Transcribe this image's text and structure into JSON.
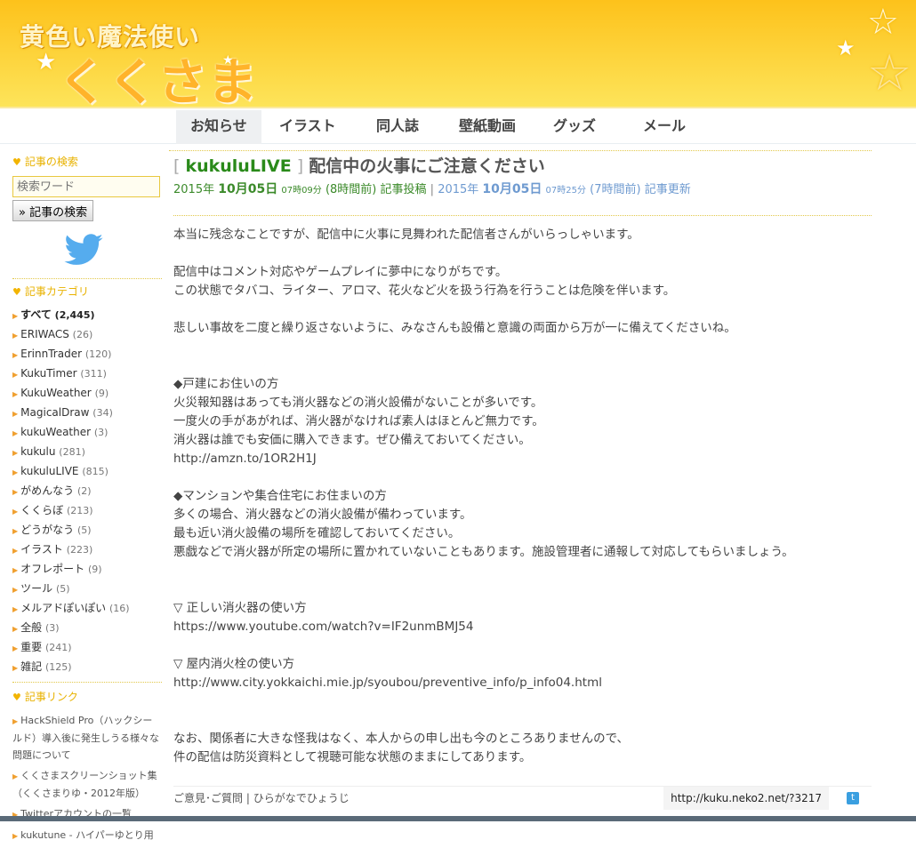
{
  "header": {
    "logo_top": "黄色い魔法使い",
    "logo_main": "くくさま"
  },
  "nav": {
    "tabs": [
      {
        "label": "お知らせ"
      },
      {
        "label": "イラスト"
      },
      {
        "label": "同人誌"
      },
      {
        "label": "壁紙動画"
      },
      {
        "label": "グッズ"
      },
      {
        "label": "メール"
      }
    ]
  },
  "sidebar": {
    "search_heading": "記事の検索",
    "search_placeholder": "検索ワード",
    "search_button": "» 記事の検索",
    "category_heading": "記事カテゴリ",
    "categories": [
      {
        "label": "すべて",
        "count": "(2,445)"
      },
      {
        "label": "ERIWACS",
        "count": "(26)"
      },
      {
        "label": "ErinnTrader",
        "count": "(120)"
      },
      {
        "label": "KukuTimer",
        "count": "(311)"
      },
      {
        "label": "KukuWeather",
        "count": "(9)"
      },
      {
        "label": "MagicalDraw",
        "count": "(34)"
      },
      {
        "label": "kukuWeather",
        "count": "(3)"
      },
      {
        "label": "kukulu",
        "count": "(281)"
      },
      {
        "label": "kukuluLIVE",
        "count": "(815)"
      },
      {
        "label": "がめんなう",
        "count": "(2)"
      },
      {
        "label": "くくらぼ",
        "count": "(213)"
      },
      {
        "label": "どうがなう",
        "count": "(5)"
      },
      {
        "label": "イラスト",
        "count": "(223)"
      },
      {
        "label": "オフレポート",
        "count": "(9)"
      },
      {
        "label": "ツール",
        "count": "(5)"
      },
      {
        "label": "メルアドぽいぽい",
        "count": "(16)"
      },
      {
        "label": "全般",
        "count": "(3)"
      },
      {
        "label": "重要",
        "count": "(241)"
      },
      {
        "label": "雑記",
        "count": "(125)"
      }
    ],
    "links_heading": "記事リンク",
    "links": [
      "HackShield Pro（ハックシールド）導入後に発生しうる様々な問題について",
      "くくさまスクリーンショット集（くくさまりゆ・2012年版）",
      "Twitterアカウントの一覧",
      "kukutune - ハイパーゆとり用"
    ]
  },
  "article": {
    "category": "kukuluLIVE",
    "title": "配信中の火事にご注意ください",
    "posted": {
      "year": "2015年",
      "date": "10月05日",
      "time": "07時09分",
      "ago": "(8時間前)",
      "label": "記事投稿"
    },
    "updated": {
      "year": "2015年",
      "date": "10月05日",
      "time": "07時25分",
      "ago": "(7時間前)",
      "label": "記事更新"
    },
    "sep": "|",
    "lines": [
      "本当に残念なことですが、配信中に火事に見舞われた配信者さんがいらっしゃいます。",
      "",
      "配信中はコメント対応やゲームプレイに夢中になりがちです。",
      "この状態でタバコ、ライター、アロマ、花火など火を扱う行為を行うことは危険を伴います。",
      "",
      "悲しい事故を二度と繰り返さないように、みなさんも設備と意識の両面から万が一に備えてくださいね。",
      "",
      "",
      "◆戸建にお住いの方",
      "火災報知器はあっても消火器などの消火設備がないことが多いです。",
      "一度火の手があがれば、消火器がなければ素人はほとんど無力です。",
      "消火器は誰でも安価に購入できます。ぜひ備えておいてください。",
      "http://amzn.to/1OR2H1J",
      "",
      "◆マンションや集合住宅にお住まいの方",
      "多くの場合、消火器などの消火設備が備わっています。",
      "最も近い消火設備の場所を確認しておいてください。",
      "悪戯などで消火器が所定の場所に置かれていないこともあります。施設管理者に通報して対応してもらいましょう。",
      "",
      "",
      "▽ 正しい消火器の使い方",
      "https://www.youtube.com/watch?v=IF2unmBMJ54",
      "",
      "▽ 屋内消火栓の使い方",
      "http://www.city.yokkaichi.mie.jp/syoubou/preventive_info/p_info04.html",
      "",
      "",
      "なお、関係者に大きな怪我はなく、本人からの申し出も今のところありませんので、",
      "件の配信は防災資料として視聴可能な状態のままにしてあります。"
    ]
  },
  "footer": {
    "feedback": "ご意見･ご質問",
    "sep": "|",
    "hiragana": "ひらがなでひょうじ",
    "url": "http://kuku.neko2.net/?3217"
  }
}
